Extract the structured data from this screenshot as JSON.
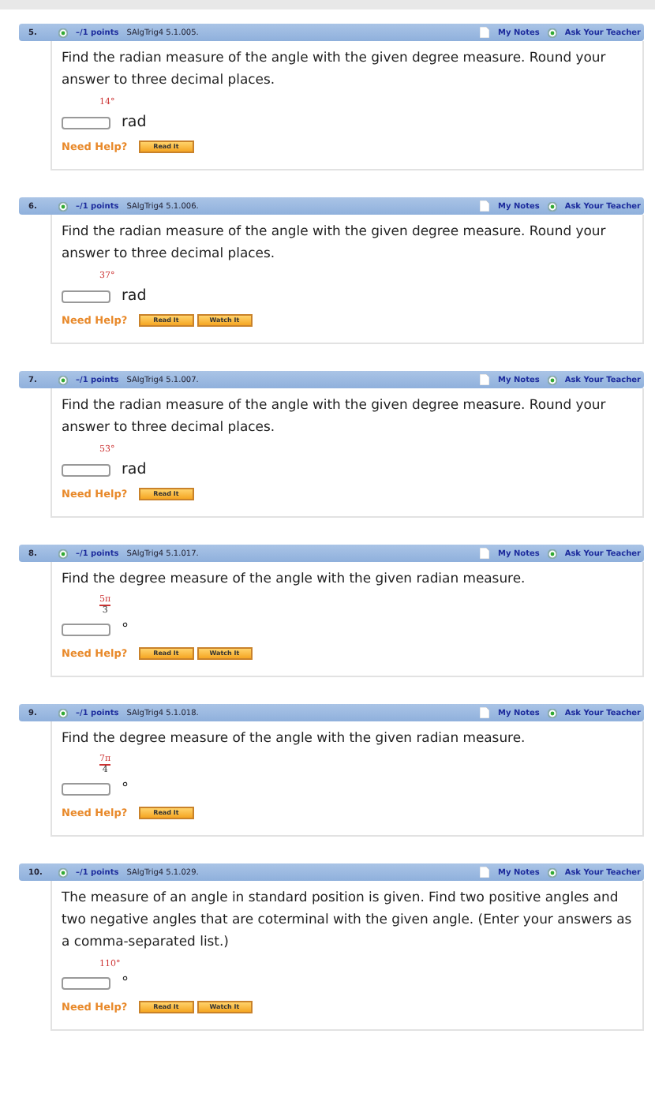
{
  "questions": [
    {
      "number": "5.",
      "points": "–/1 points",
      "code": "SAlgTrig4 5.1.005.",
      "notes": "My Notes",
      "ask": "Ask Your Teacher",
      "text": "Find the radian measure of the angle with the given degree measure. Round your answer to three decimal places.",
      "given": {
        "kind": "degree",
        "value": "14°"
      },
      "unit": "rad",
      "help": "Need Help?",
      "buttons": [
        "Read It"
      ]
    },
    {
      "number": "6.",
      "points": "–/1 points",
      "code": "SAlgTrig4 5.1.006.",
      "notes": "My Notes",
      "ask": "Ask Your Teacher",
      "text": "Find the radian measure of the angle with the given degree measure. Round your answer to three decimal places.",
      "given": {
        "kind": "degree",
        "value": "37°"
      },
      "unit": "rad",
      "help": "Need Help?",
      "buttons": [
        "Read It",
        "Watch It"
      ]
    },
    {
      "number": "7.",
      "points": "–/1 points",
      "code": "SAlgTrig4 5.1.007.",
      "notes": "My Notes",
      "ask": "Ask Your Teacher",
      "text": "Find the radian measure of the angle with the given degree measure. Round your answer to three decimal places.",
      "given": {
        "kind": "degree",
        "value": "53°"
      },
      "unit": "rad",
      "help": "Need Help?",
      "buttons": [
        "Read It"
      ]
    },
    {
      "number": "8.",
      "points": "–/1 points",
      "code": "SAlgTrig4 5.1.017.",
      "notes": "My Notes",
      "ask": "Ask Your Teacher",
      "text": "Find the degree measure of the angle with the given radian measure.",
      "given": {
        "kind": "fraction",
        "numerator": "5π",
        "denominator": "3"
      },
      "unit": "°",
      "help": "Need Help?",
      "buttons": [
        "Read It",
        "Watch It"
      ]
    },
    {
      "number": "9.",
      "points": "–/1 points",
      "code": "SAlgTrig4 5.1.018.",
      "notes": "My Notes",
      "ask": "Ask Your Teacher",
      "text": "Find the degree measure of the angle with the given radian measure.",
      "given": {
        "kind": "fraction",
        "numerator": "7π",
        "denominator": "4"
      },
      "unit": "°",
      "help": "Need Help?",
      "buttons": [
        "Read It"
      ]
    },
    {
      "number": "10.",
      "points": "–/1 points",
      "code": "SAlgTrig4 5.1.029.",
      "notes": "My Notes",
      "ask": "Ask Your Teacher",
      "text": "The measure of an angle in standard position is given. Find two positive angles and two negative angles that are coterminal with the given angle. (Enter your answers as a comma-separated list.)",
      "given": {
        "kind": "degree",
        "value": "110°"
      },
      "unit": "°",
      "help": "Need Help?",
      "buttons": [
        "Read It",
        "Watch It"
      ]
    }
  ]
}
